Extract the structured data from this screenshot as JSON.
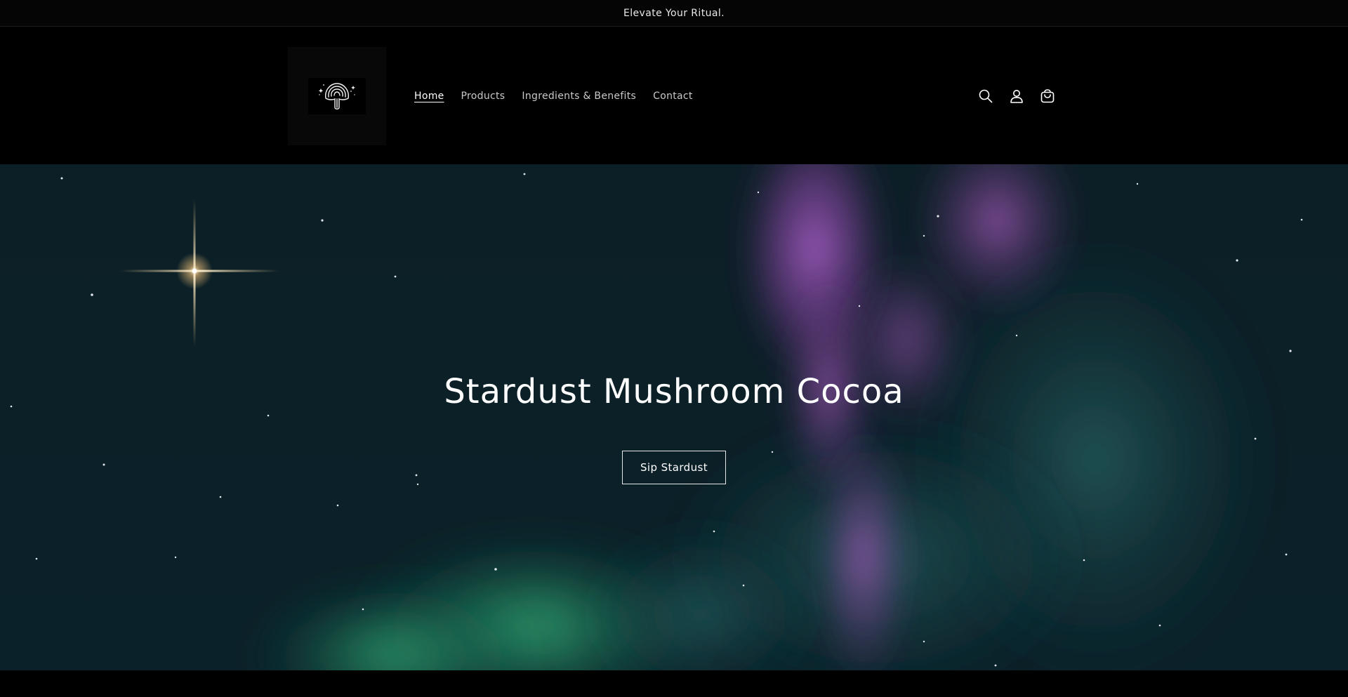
{
  "announcement": {
    "text": "Elevate Your Ritual."
  },
  "header": {
    "logo_icon": "mushroom-icon",
    "nav": [
      {
        "label": "Home",
        "active": true
      },
      {
        "label": "Products",
        "active": false
      },
      {
        "label": "Ingredients & Benefits",
        "active": false
      },
      {
        "label": "Contact",
        "active": false
      }
    ],
    "icons": [
      "search-icon",
      "account-icon",
      "cart-icon"
    ]
  },
  "hero": {
    "title": "Stardust Mushroom Cocoa",
    "button_label": "Sip Stardust"
  },
  "colors": {
    "background": "#000000",
    "hero_base": "#0a1c22",
    "aurora_purple": "#9a55b8",
    "aurora_green": "#2fa36e",
    "text": "#ffffff"
  }
}
